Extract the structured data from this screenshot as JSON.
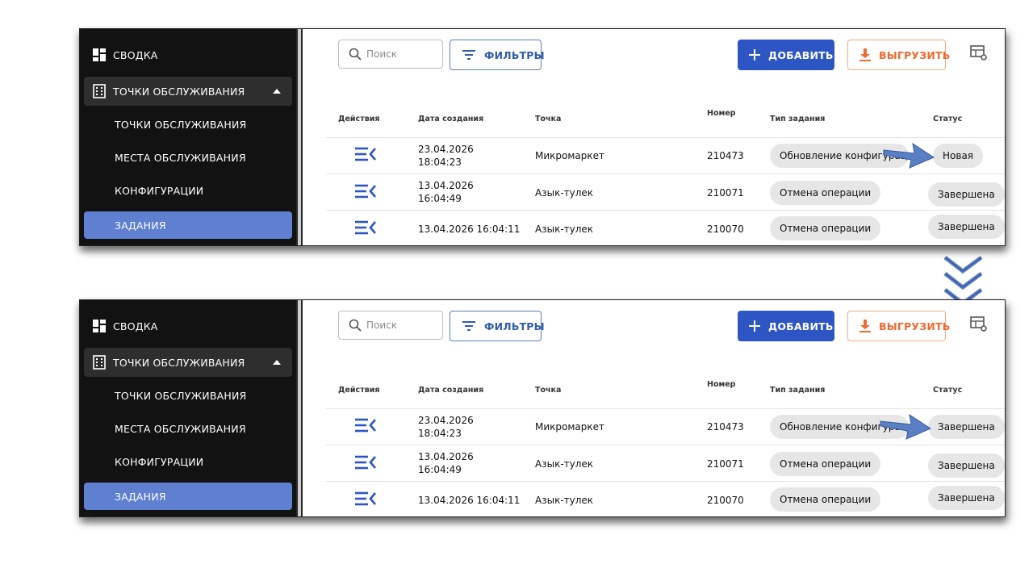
{
  "screens": [
    {
      "sidebar": {
        "summary": "СВОДКА",
        "group": "ТОЧКИ ОБСЛУЖИВАНИЯ",
        "items": [
          "ТОЧКИ ОБСЛУЖИВАНИЯ",
          "МЕСТА ОБСЛУЖИВАНИЯ",
          "КОНФИГУРАЦИИ",
          "ЗАДАНИЯ"
        ]
      },
      "toolbar": {
        "search_placeholder": "Поиск",
        "filters": "ФИЛЬТРЫ",
        "add": "ДОБАВИТЬ",
        "export": "ВЫГРУЗИТЬ"
      },
      "columns": [
        "Действия",
        "Дата создания",
        "Точка",
        "Номер",
        "Тип задания",
        "Статус"
      ],
      "rows": [
        {
          "date1": "23.04.2026",
          "date2": "18:04:23",
          "point": "Микромаркет",
          "number": "210473",
          "type": "Обновление конфигурации",
          "status": "Новая"
        },
        {
          "date1": "13.04.2026",
          "date2": "16:04:49",
          "point": "Азык-тулек",
          "number": "210071",
          "type": "Отмена операции",
          "status": "Завершена"
        },
        {
          "date1": "13.04.2026 16:04:11",
          "date2": "",
          "point": "Азык-тулек",
          "number": "210070",
          "type": "Отмена операции",
          "status": "Завершена"
        }
      ]
    },
    {
      "sidebar": {
        "summary": "СВОДКА",
        "group": "ТОЧКИ ОБСЛУЖИВАНИЯ",
        "items": [
          "ТОЧКИ ОБСЛУЖИВАНИЯ",
          "МЕСТА ОБСЛУЖИВАНИЯ",
          "КОНФИГУРАЦИИ",
          "ЗАДАНИЯ"
        ]
      },
      "toolbar": {
        "search_placeholder": "Поиск",
        "filters": "ФИЛЬТРЫ",
        "add": "ДОБАВИТЬ",
        "export": "ВЫГРУЗИТЬ"
      },
      "columns": [
        "Действия",
        "Дата создания",
        "Точка",
        "Номер",
        "Тип задания",
        "Статус"
      ],
      "rows": [
        {
          "date1": "23.04.2026",
          "date2": "18:04:23",
          "point": "Микромаркет",
          "number": "210473",
          "type": "Обновление конфигурации",
          "status": "Завершена"
        },
        {
          "date1": "13.04.2026",
          "date2": "16:04:49",
          "point": "Азык-тулек",
          "number": "210071",
          "type": "Отмена операции",
          "status": "Завершена"
        },
        {
          "date1": "13.04.2026 16:04:11",
          "date2": "",
          "point": "Азык-тулек",
          "number": "210070",
          "type": "Отмена операции",
          "status": "Завершена"
        }
      ]
    }
  ],
  "colors": {
    "sidebar_bg": "#121212",
    "active_item": "#5f7fd1",
    "add_button": "#2d55c4",
    "export_accent": "#ef6a2f",
    "annotation_arrow": "#5b7fc4"
  },
  "icons": [
    "dashboard-icon",
    "building-icon",
    "search-icon",
    "filter-icon",
    "plus-icon",
    "download-icon",
    "table-settings-icon",
    "actions-menu-icon",
    "chevron-down-icon"
  ]
}
